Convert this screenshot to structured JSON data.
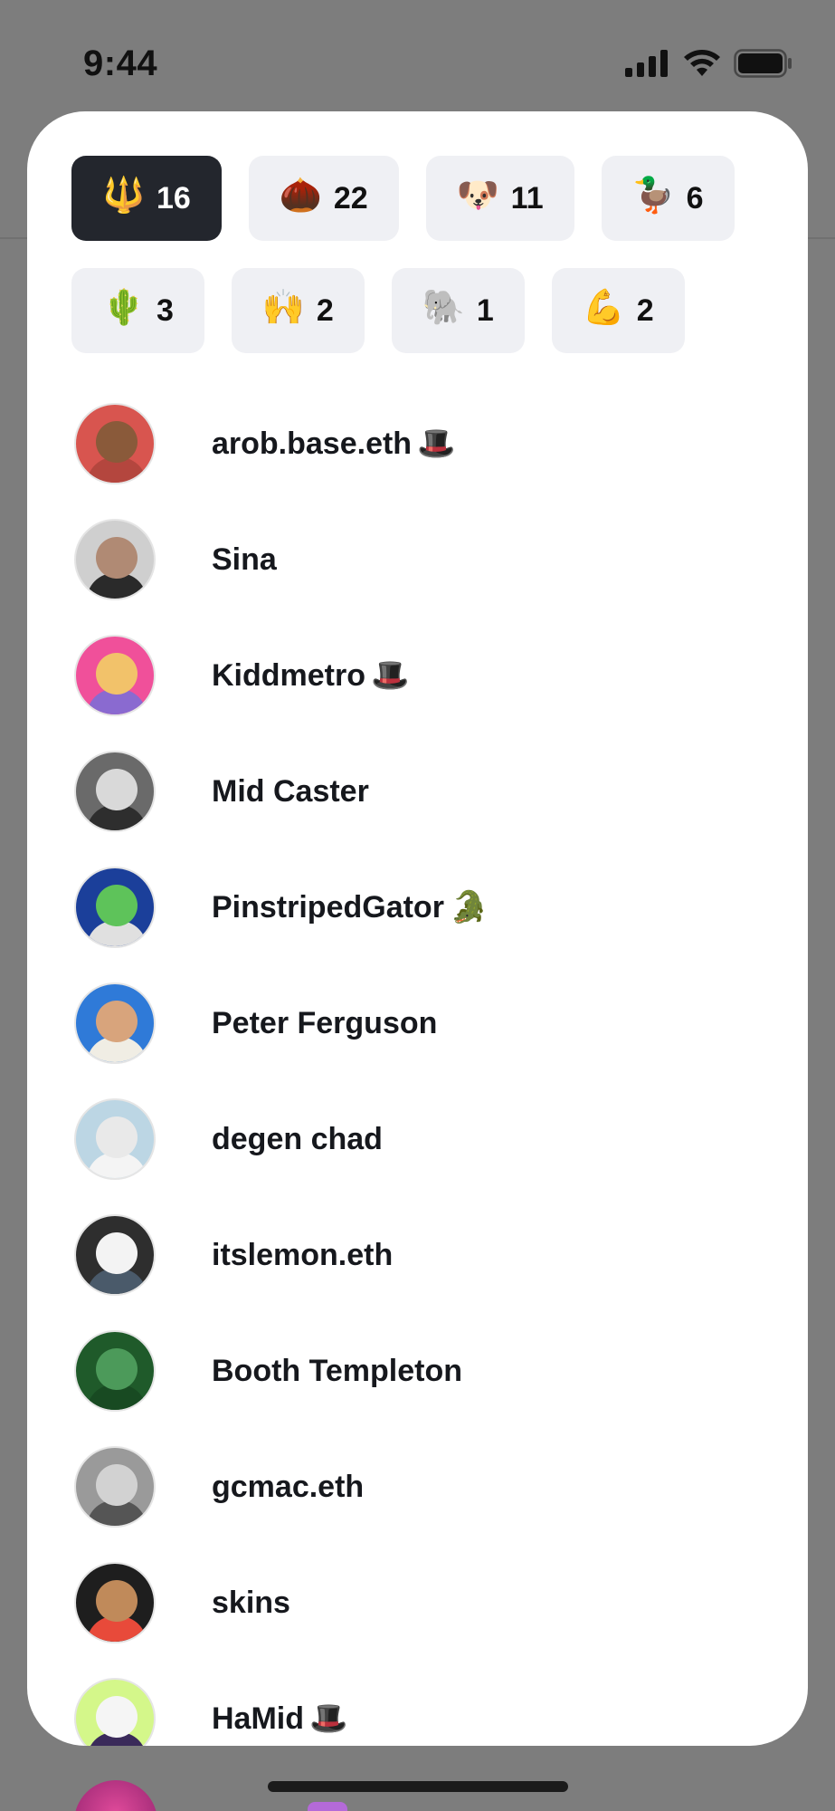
{
  "status_bar": {
    "time": "9:44",
    "icons": [
      "signal-icon",
      "wifi-icon",
      "battery-icon"
    ]
  },
  "reactions": [
    {
      "icon": "trident-icon",
      "emoji": "🔱",
      "count": "16",
      "active": true
    },
    {
      "icon": "chestnut-icon",
      "emoji": "🌰",
      "count": "22",
      "active": false
    },
    {
      "icon": "dog-face-icon",
      "emoji": "🐶",
      "count": "11",
      "active": false
    },
    {
      "icon": "duck-icon",
      "emoji": "🦆",
      "count": "6",
      "active": false
    },
    {
      "icon": "cactus-icon",
      "emoji": "🌵",
      "count": "3",
      "active": false
    },
    {
      "icon": "raising-hands-icon",
      "emoji": "🙌",
      "count": "2",
      "active": false
    },
    {
      "icon": "elephant-icon",
      "emoji": "🐘",
      "count": "1",
      "active": false
    },
    {
      "icon": "flexed-biceps-icon",
      "emoji": "💪",
      "count": "2",
      "active": false
    }
  ],
  "users": [
    {
      "name": "arob.base.eth",
      "suffix": " 🎩",
      "avatar_bg": "#d8554f",
      "face": "#8a5a3a",
      "body": "#b4463e"
    },
    {
      "name": "Sina",
      "suffix": "",
      "avatar_bg": "#cfcfcf",
      "face": "#b08a74",
      "body": "#2a2a2a"
    },
    {
      "name": "Kiddmetro",
      "suffix": " 🎩",
      "avatar_bg": "#f0509a",
      "face": "#f2c26a",
      "body": "#8a6ad0"
    },
    {
      "name": "Mid Caster",
      "suffix": "",
      "avatar_bg": "#6a6a6a",
      "face": "#d9d9d9",
      "body": "#2e2e2e"
    },
    {
      "name": "PinstripedGator",
      "suffix": "🐊",
      "avatar_bg": "#1b3f9a",
      "face": "#5ec35a",
      "body": "#e0e0e0"
    },
    {
      "name": "Peter Ferguson",
      "suffix": "",
      "avatar_bg": "#2f7ad8",
      "face": "#d8a47c",
      "body": "#f0ede4"
    },
    {
      "name": "degen chad",
      "suffix": "",
      "avatar_bg": "#bcd6e4",
      "face": "#e9e9e9",
      "body": "#f4f4f4"
    },
    {
      "name": "itslemon.eth",
      "suffix": "",
      "avatar_bg": "#2e2e2e",
      "face": "#f3f3f3",
      "body": "#4a5a6a"
    },
    {
      "name": "Booth Templeton",
      "suffix": "",
      "avatar_bg": "#1f5a2a",
      "face": "#4c9a5a",
      "body": "#184a22"
    },
    {
      "name": "gcmac.eth",
      "suffix": "",
      "avatar_bg": "#9a9a9a",
      "face": "#d2d2d2",
      "body": "#555555"
    },
    {
      "name": "skins",
      "suffix": "",
      "avatar_bg": "#1e1e1e",
      "face": "#c08a5a",
      "body": "#e84a3a"
    },
    {
      "name": "HaMid",
      "suffix": "🎩",
      "avatar_bg": "#d4f78a",
      "face": "#f5f5f5",
      "body": "#3a2a5a"
    }
  ]
}
